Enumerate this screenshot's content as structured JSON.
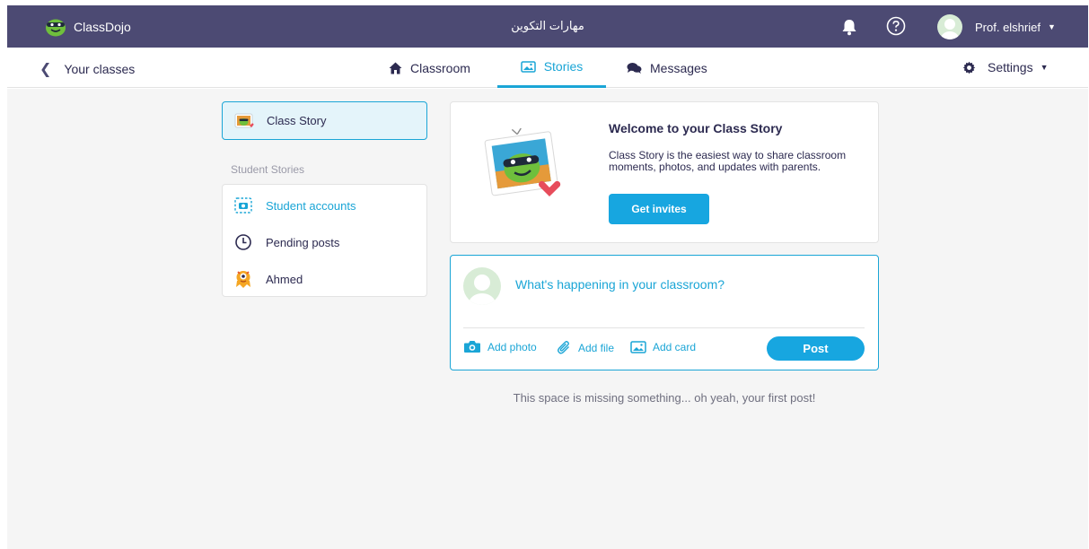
{
  "topbar": {
    "brand": "ClassDojo",
    "class_title": "مهارات التكوين",
    "user_name": "Prof. elshrief",
    "icons": {
      "bell": "bell-icon",
      "help": "help-icon",
      "caret": "caret-down-icon"
    }
  },
  "subnav": {
    "back_label": "Your classes",
    "tabs": [
      {
        "label": "Classroom",
        "icon": "home-icon"
      },
      {
        "label": "Stories",
        "icon": "stories-icon",
        "active": true
      },
      {
        "label": "Messages",
        "icon": "chat-icon"
      }
    ],
    "settings_label": "Settings"
  },
  "sidebar": {
    "class_story": "Class Story",
    "section_heading": "Student Stories",
    "items": [
      {
        "label": "Student accounts",
        "icon": "student-accounts-icon"
      },
      {
        "label": "Pending posts",
        "icon": "clock-icon"
      },
      {
        "label": "Ahmed",
        "icon": "monster-avatar-icon"
      }
    ]
  },
  "welcome": {
    "title": "Welcome to your Class Story",
    "description": "Class Story is the easiest way to share classroom moments, photos, and updates with parents.",
    "button": "Get invites"
  },
  "composer": {
    "prompt": "What's happening in your classroom?",
    "actions": [
      "Add photo",
      "Add file",
      "Add card"
    ],
    "post": "Post"
  },
  "empty_message": "This space is missing something... oh yeah, your first post!",
  "colors": {
    "topbar": "#4c4a73",
    "accent": "#1aa5d6",
    "background": "#f5f5f5"
  }
}
